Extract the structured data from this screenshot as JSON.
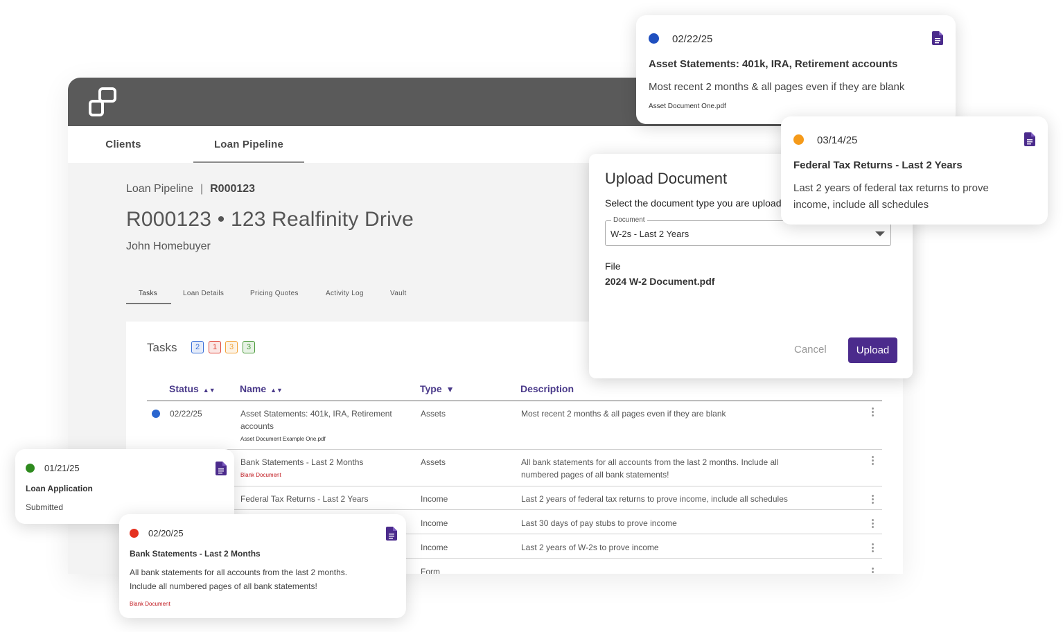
{
  "nav": {
    "tabs": [
      {
        "label": "Clients"
      },
      {
        "label": "Loan Pipeline",
        "active": true
      }
    ]
  },
  "breadcrumb": {
    "parent": "Loan Pipeline",
    "separator": "|",
    "current": "R000123"
  },
  "page": {
    "title": "R000123 • 123 Realfinity Drive",
    "client": "John Homebuyer"
  },
  "subtabs": [
    "Tasks",
    "Loan Details",
    "Pricing Quotes",
    "Activity Log",
    "Vault"
  ],
  "tasks": {
    "title": "Tasks",
    "badges": [
      {
        "count": "2",
        "color": "#3a6fd8"
      },
      {
        "count": "1",
        "color": "#e0483c"
      },
      {
        "count": "3",
        "color": "#f2a33a"
      },
      {
        "count": "3",
        "color": "#4a9a3a"
      }
    ],
    "columns": [
      "Status",
      "Name",
      "Type",
      "Description"
    ],
    "rows": [
      {
        "status_date": "02/22/25",
        "status_color": "#2b66cf",
        "name_line1": "Asset Statements: 401k, IRA, Retirement",
        "name_line2": "accounts",
        "file": "Asset Document Example One.pdf",
        "type": "Assets",
        "description": "Most recent 2 months & all pages even if they are blank"
      },
      {
        "name": "Bank Statements - Last 2 Months",
        "tag": "Blank Document",
        "type": "Assets",
        "description_line1": "All bank statements for all accounts from the last 2 months. Include all",
        "description_line2": "numbered pages of all bank statements!"
      },
      {
        "name": "Federal Tax Returns - Last 2 Years",
        "type": "Income",
        "description": "Last 2 years of federal tax returns to prove income, include all schedules"
      },
      {
        "type": "Income",
        "description": "Last 30 days of pay stubs to prove income"
      },
      {
        "type": "Income",
        "description": "Last 2 years of W-2s to prove income"
      },
      {
        "type": "Form",
        "description": ""
      }
    ]
  },
  "upload": {
    "title": "Upload Document",
    "instruction": "Select the document type you are uploading",
    "select_label": "Document",
    "select_value": "W-2s - Last 2 Years",
    "file_label": "File",
    "file_name": "2024 W-2 Document.pdf",
    "cancel": "Cancel",
    "submit": "Upload"
  },
  "cards": {
    "asset": {
      "date": "02/22/25",
      "dot_color": "#1f4fbf",
      "title": "Asset Statements: 401k, IRA, Retirement accounts",
      "desc": "Most recent 2 months & all pages even if they are blank",
      "file": "Asset Document One.pdf"
    },
    "tax": {
      "date": "03/14/25",
      "dot_color": "#f59a1a",
      "title": "Federal Tax Returns - Last 2 Years",
      "desc_line1": "Last 2 years of federal tax returns to prove",
      "desc_line2": "income, include all schedules"
    },
    "loan": {
      "date": "01/21/25",
      "dot_color": "#2e8a1e",
      "title": "Loan Application",
      "desc": "Submitted"
    },
    "bank": {
      "date": "02/20/25",
      "dot_color": "#e5311f",
      "title": "Bank Statements - Last 2 Months",
      "desc_line1": "All bank statements for all accounts from the last 2 months.",
      "desc_line2": "Include all numbered pages of all bank statements!",
      "tag": "Blank Document"
    }
  },
  "colors": {
    "accent": "#4b2b8c",
    "header": "#5a5a5a",
    "blank_tag": "#c0161c"
  }
}
